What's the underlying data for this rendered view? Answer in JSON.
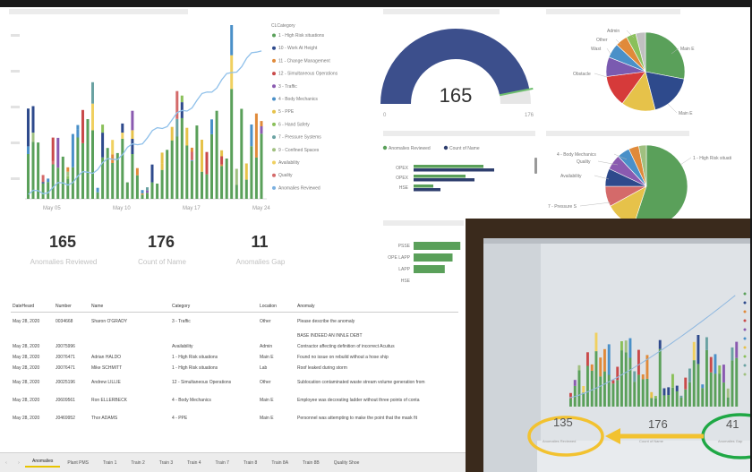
{
  "kpis": {
    "reviewed": {
      "value": "165",
      "label": "Anomalies Reviewed"
    },
    "count": {
      "value": "176",
      "label": "Count of Name"
    },
    "gap": {
      "value": "11",
      "label": "Anomalies Gap"
    }
  },
  "gauge": {
    "value": "165",
    "min": "0",
    "max": "176",
    "fraction": 0.9375
  },
  "main_chart": {
    "x_ticks": [
      "May 05",
      "May 10",
      "May 17",
      "May 24"
    ],
    "legend_title": "CLCategory",
    "legend": [
      {
        "label": "1 - High Risk situations",
        "color": "#5aa05a"
      },
      {
        "label": "10 - Work At Height",
        "color": "#2e4a8c"
      },
      {
        "label": "11 - Change Management",
        "color": "#e08a3a"
      },
      {
        "label": "12 - Simultaneous Operations",
        "color": "#c94a4a"
      },
      {
        "label": "3 - Traffic",
        "color": "#8a5ab0"
      },
      {
        "label": "4 - Body Mechanics",
        "color": "#4a90c8"
      },
      {
        "label": "5 - PPE",
        "color": "#e6c24a"
      },
      {
        "label": "6 - Hand Safety",
        "color": "#8ac05a"
      },
      {
        "label": "7 - Pressure Systems",
        "color": "#6aa2a2"
      },
      {
        "label": "9 - Confined Spaces",
        "color": "#a0c080"
      },
      {
        "label": "Availability",
        "color": "#f0d060"
      },
      {
        "label": "Quality",
        "color": "#d46a6a"
      },
      {
        "label": "Anomalies Reviewed",
        "color": "#7ab0e0"
      }
    ]
  },
  "bar_chart_1": {
    "legend": [
      {
        "label": "Anomalies Reviewed",
        "color": "#5aa05a"
      },
      {
        "label": "Count of Name",
        "color": "#2e3e6e"
      }
    ],
    "categories": [
      "OPEX",
      "OPEX",
      "HSE"
    ],
    "series": [
      {
        "values": [
          0.78,
          0.58,
          0.22
        ]
      },
      {
        "values": [
          0.9,
          0.68,
          0.3
        ]
      }
    ]
  },
  "bar_chart_2": {
    "categories": [
      "PSSE",
      "OPE LAPP",
      "LAPP",
      "HSE"
    ],
    "values": [
      0.9,
      0.75,
      0.6,
      0
    ]
  },
  "pie_top": {
    "labels": [
      "Admin",
      "Other",
      "Wast",
      "Obstacle",
      "Main E",
      "Main E"
    ],
    "slices": [
      {
        "value": 28,
        "color": "#5aa05a"
      },
      {
        "value": 18,
        "color": "#2e4a8c"
      },
      {
        "value": 14,
        "color": "#e6c24a"
      },
      {
        "value": 13,
        "color": "#d63a3a"
      },
      {
        "value": 8,
        "color": "#7a5ab0"
      },
      {
        "value": 6,
        "color": "#4a90c8"
      },
      {
        "value": 5,
        "color": "#e08a3a"
      },
      {
        "value": 4,
        "color": "#8ac05a"
      },
      {
        "value": 4,
        "color": "#c0c0c0"
      }
    ]
  },
  "pie_bottom": {
    "labels": [
      "4 - Body Mechanics",
      "Quality",
      "Availability",
      "7 - Pressure S",
      "1 - High Risk situati"
    ],
    "slices": [
      {
        "value": 55,
        "color": "#5aa05a"
      },
      {
        "value": 12,
        "color": "#e6c24a"
      },
      {
        "value": 8,
        "color": "#d46a6a"
      },
      {
        "value": 7,
        "color": "#2e4a8c"
      },
      {
        "value": 6,
        "color": "#8a5ab0"
      },
      {
        "value": 5,
        "color": "#4a90c8"
      },
      {
        "value": 4,
        "color": "#e08a3a"
      },
      {
        "value": 3,
        "color": "#a0c080"
      }
    ]
  },
  "table": {
    "headers": [
      "DateHeard",
      "Number",
      "Name",
      "Category",
      "Location",
      "Anomaly"
    ],
    "rows": [
      {
        "date": "May 28, 2020",
        "number": "0034668",
        "name": "Sharon O'GRADY",
        "category": "3 - Traffic",
        "location": "Other",
        "anomaly": "Please describe the anomaly",
        "tall": true
      },
      {
        "date": "",
        "number": "",
        "name": "",
        "category": "",
        "location": "",
        "anomaly": "BASE INDEED AN INNLE DEBT",
        "tall": false
      },
      {
        "date": "May 28, 2020",
        "number": "J0075996",
        "name": "",
        "category": "Availability",
        "location": "Admin",
        "anomaly": "Contractor affecting definition of incorrect Acuitus",
        "tall": false
      },
      {
        "date": "May 28, 2020",
        "number": "J0076471",
        "name": "Adrian HALDO",
        "category": "1 - High Risk situations",
        "location": "Main E",
        "anomaly": "Found no issue on rebuild without a hose ship",
        "tall": false
      },
      {
        "date": "May 28, 2020",
        "number": "J0076471",
        "name": "Mike SCHMITT",
        "category": "1 - High Risk situations",
        "location": "Lab",
        "anomaly": "Roof leaked during storm",
        "tall": false
      },
      {
        "date": "May 28, 2020",
        "number": "J0025196",
        "name": "Andrew LILLIE",
        "category": "12 - Simultaneous Operations",
        "location": "Other",
        "anomaly": "Sublocation contaminated waste stream volume generation from",
        "tall": true
      },
      {
        "date": "May 28, 2020",
        "number": "J0609561",
        "name": "Ron ELLERBECK",
        "category": "4 - Body Mechanics",
        "location": "Main E",
        "anomaly": "Employee was decorating ladder without three points of conta",
        "tall": true
      },
      {
        "date": "May 28, 2020",
        "number": "J0469952",
        "name": "Thor ADAMS",
        "category": "4 - PPE",
        "location": "Main E",
        "anomaly": "Personnel was attempting to make the point that the mask fit",
        "tall": true
      }
    ]
  },
  "tabs": [
    "Anomalies",
    "Plant PMS",
    "Train 1",
    "Train 2",
    "Train 3",
    "Train 4",
    "Train 7",
    "Train 8",
    "Train 8A",
    "Train 8B",
    "Quality Shoe"
  ],
  "active_tab": 0,
  "photo": {
    "kpi_left": {
      "value": "135",
      "label": "Anomalies Reviewed"
    },
    "kpi_mid": {
      "value": "176",
      "label": "Count of Name"
    },
    "kpi_right": {
      "value": "41",
      "label": "Anomalies Gap"
    },
    "highlight_left_color": "#f2c230",
    "highlight_right_color": "#1fa845"
  }
}
